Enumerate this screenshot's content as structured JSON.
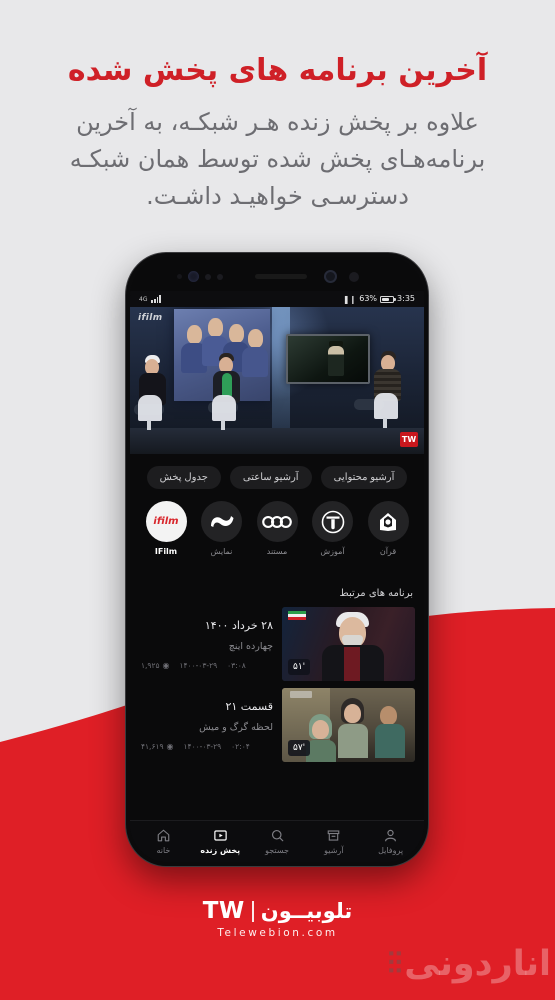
{
  "header": {
    "title": "آخرین برنامه های پخش شده",
    "subtitle": "علاوه بر پخش زنده هـر شبکـه، به آخرین برنامه‌هـای پخش شده توسط همان شبکـه دسترسـی خواهیـد داشـت.",
    "title_color": "#cf2027",
    "subtitle_color": "#6d6d72"
  },
  "background": {
    "light_color": "#e8e8ea",
    "red_color": "#df1f26"
  },
  "phone": {
    "status_bar": {
      "signal_label": "4G",
      "vibrate_icon": "vibrate-icon",
      "battery_percent": "63%",
      "clock": "3:35"
    },
    "player": {
      "channel_watermark": "ifilm",
      "corner_watermark": "TW"
    },
    "chips": [
      {
        "label": "آرشیو محتوایی"
      },
      {
        "label": "آرشیو ساعتی"
      },
      {
        "label": "جدول پخش"
      }
    ],
    "channels": [
      {
        "label": "قرآن",
        "icon": "quran-icon",
        "active": false
      },
      {
        "label": "آموزش",
        "icon": "amoozesh-icon",
        "active": false
      },
      {
        "label": "مستند",
        "icon": "mostanad-icon",
        "active": false
      },
      {
        "label": "نمایش",
        "icon": "namayesh-icon",
        "active": false
      },
      {
        "label": "IFilm",
        "icon": "ifilm-icon",
        "active": true
      }
    ],
    "related": {
      "heading": "برنامه های مرتبط",
      "items": [
        {
          "title": "۲۸ خرداد ۱۴۰۰",
          "subtitle": "چهارده اینچ",
          "views": "۱,۹۲۵",
          "date": "۱۴۰۰-۰۳-۲۹",
          "time": "۰۳:۰۸",
          "duration": "۵۱'"
        },
        {
          "title": "قسمت ۲۱",
          "subtitle": "لحظه گرگ و میش",
          "views": "۴۱,۶۱۹",
          "date": "۱۴۰۰-۰۳-۲۹",
          "time": "۰۲:۰۴",
          "duration": "۵۷'"
        }
      ]
    },
    "bottom_nav": [
      {
        "label": "خانه",
        "icon": "home-icon",
        "active": false
      },
      {
        "label": "پخش زنده",
        "icon": "live-play-icon",
        "active": true
      },
      {
        "label": "جستجو",
        "icon": "search-icon",
        "active": false
      },
      {
        "label": "آرشیو",
        "icon": "archive-icon",
        "active": false
      },
      {
        "label": "پروفایل",
        "icon": "profile-icon",
        "active": false
      }
    ]
  },
  "footer": {
    "brand_fa": "تلوبیــون",
    "brand_en": "TW",
    "url": "Telewebion.com"
  },
  "watermark": {
    "text": "اناردونی"
  }
}
